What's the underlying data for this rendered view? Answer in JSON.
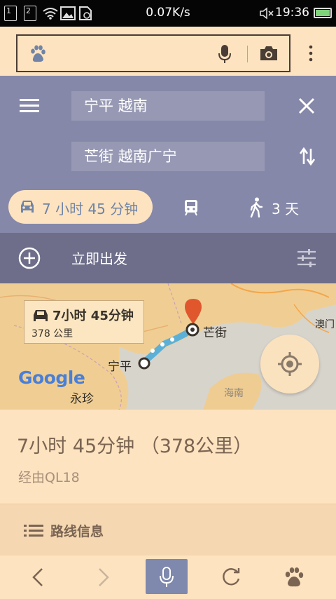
{
  "status_bar": {
    "sim1": "1",
    "sim2": "2",
    "network_speed": "0.07K/s",
    "time": "19:36"
  },
  "browser": {
    "search_placeholder": ""
  },
  "route": {
    "origin": "宁平 越南",
    "destination": "芒街 越南广宁",
    "modes": {
      "drive_label": "7 小时 45 分钟",
      "walk_label": "3 天"
    },
    "depart_label": "立即出发"
  },
  "map": {
    "callout_time": "7小时 45分钟",
    "callout_distance": "378 公里",
    "place_start": "宁平",
    "place_end": "芒街",
    "place_other": [
      "永珍",
      "海南",
      "澳门"
    ],
    "google_logo": "Google"
  },
  "summary": {
    "duration_distance": "7小时 45分钟 （378公里）",
    "via": "经由QL18",
    "route_info_label": "路线信息"
  },
  "colors": {
    "accent": "#8588a9",
    "pill_bg": "#fde3c0",
    "route_line": "#5cb0d6",
    "map_land": "#f0ce93"
  }
}
